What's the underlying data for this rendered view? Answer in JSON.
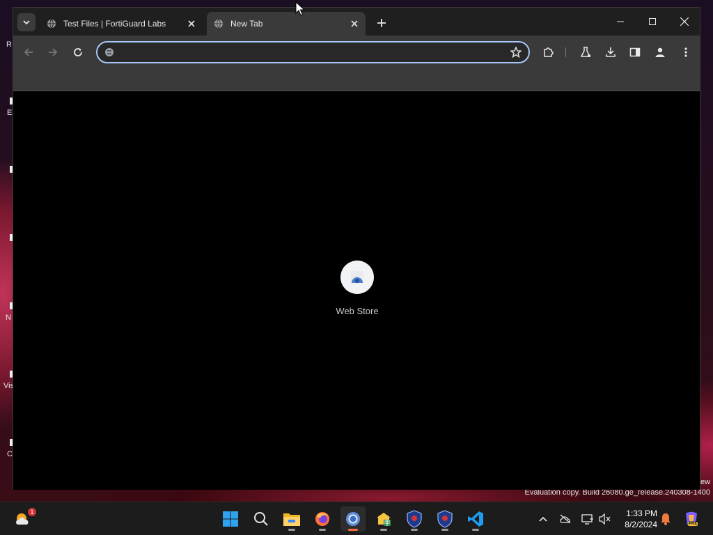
{
  "desktop": {
    "icon_labels": [
      "R",
      "E",
      "N",
      "Vis",
      "C"
    ],
    "right_label": "ew",
    "watermark": "Evaluation copy. Build 26080.ge_release.240308-1400"
  },
  "browser": {
    "tabs": [
      {
        "title": "Test Files | FortiGuard Labs",
        "active": false
      },
      {
        "title": "New Tab",
        "active": true
      }
    ],
    "omnibox": {
      "value": "",
      "placeholder": ""
    },
    "shortcuts": [
      {
        "label": "Web Store",
        "icon": "web-store-icon"
      }
    ],
    "accent": "#a8c7fa"
  },
  "taskbar": {
    "weather_badge": "1",
    "apps": [
      "start-icon",
      "search-icon",
      "file-explorer-icon",
      "firefox-icon",
      "chrome-icon",
      "network-app-icon",
      "shield-app-icon",
      "shield-app-icon-2",
      "vscode-icon"
    ],
    "clock": {
      "time": "1:33 PM",
      "date": "8/2/2024"
    },
    "copilot_badge": "PRE"
  }
}
